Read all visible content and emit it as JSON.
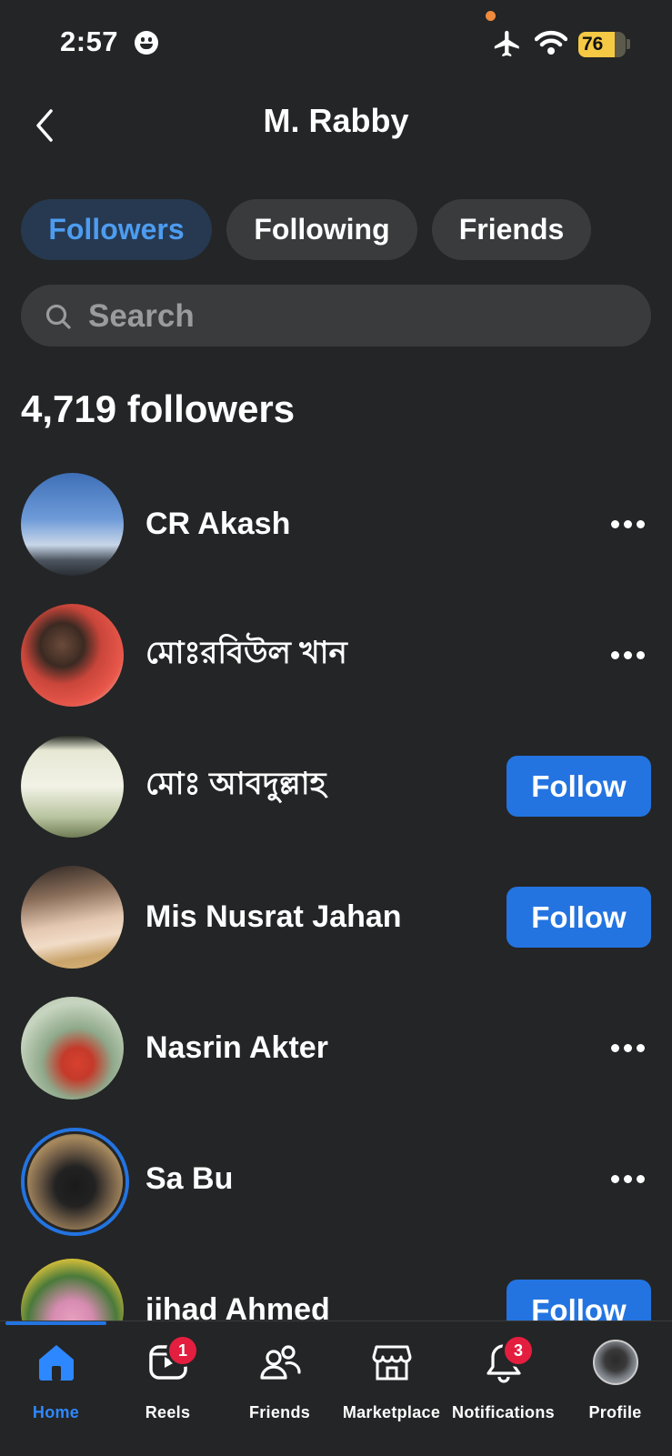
{
  "status_bar": {
    "time": "2:57",
    "battery_percent": "76"
  },
  "header": {
    "title": "M. Rabby"
  },
  "tabs": [
    {
      "label": "Followers",
      "active": true
    },
    {
      "label": "Following",
      "active": false
    },
    {
      "label": "Friends",
      "active": false
    }
  ],
  "search": {
    "placeholder": "Search"
  },
  "followers_count": "4,719 followers",
  "followers": [
    {
      "name": "CR Akash",
      "action": "more"
    },
    {
      "name": "মোঃরবিউল খান",
      "action": "more"
    },
    {
      "name": "মোঃ আবদুল্লাহ",
      "action": "follow",
      "button_label": "Follow"
    },
    {
      "name": "Mis Nusrat Jahan",
      "action": "follow",
      "button_label": "Follow"
    },
    {
      "name": "Nasrin Akter",
      "action": "more"
    },
    {
      "name": "Sa Bu",
      "action": "more"
    },
    {
      "name": "jihad Ahmed",
      "action": "follow",
      "button_label": "Follow"
    }
  ],
  "bottom_nav": [
    {
      "label": "Home",
      "icon": "home-icon",
      "active": true
    },
    {
      "label": "Reels",
      "icon": "reels-icon",
      "badge": "1"
    },
    {
      "label": "Friends",
      "icon": "friends-icon"
    },
    {
      "label": "Marketplace",
      "icon": "marketplace-icon"
    },
    {
      "label": "Notifications",
      "icon": "bell-icon",
      "badge": "3"
    },
    {
      "label": "Profile",
      "icon": "profile-avatar"
    }
  ],
  "colors": {
    "background": "#242526",
    "accent": "#2374e1",
    "active_tab_bg": "#263951",
    "active_tab_text": "#4d9cf0",
    "badge": "#e41e3f"
  }
}
